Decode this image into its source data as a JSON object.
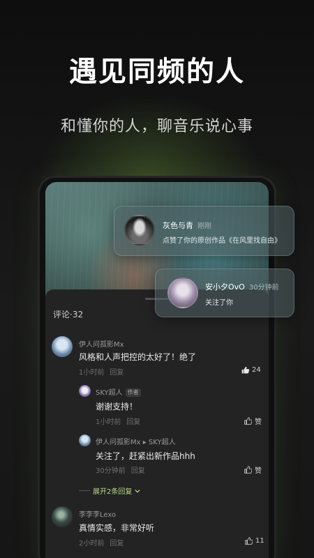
{
  "hero": {
    "title": "遇见同频的人",
    "subtitle": "和懂你的人，聊音乐说心事"
  },
  "notifications": [
    {
      "name": "灰色与青",
      "time": "刚刚",
      "desc": "点赞了你的原创作品《在风里找自由》"
    },
    {
      "name": "安小夕OvO",
      "time": "30分钟前",
      "desc": "关注了你"
    }
  ],
  "comments": {
    "header": "评论·32",
    "items": [
      {
        "user": "伊人问孤影Mx",
        "text": "风格和人声把控的太好了！绝了",
        "time": "1小时前",
        "reply": "回复",
        "likes": "24"
      },
      {
        "user": "SKY超人",
        "author_tag": "作者",
        "text": "谢谢支持！",
        "time": "1小时前",
        "reply": "回复",
        "likes": "赞"
      },
      {
        "user": "伊人问孤影Mx ▸ SKY超人",
        "text": "关注了，赶紧出新作品hhh",
        "time": "30分钟前",
        "reply": "回复",
        "likes": "赞"
      },
      {
        "user": "李李李Lexo",
        "text": "真情实感，非常好听",
        "time": "2小时前",
        "reply": "回复",
        "likes": "11"
      }
    ],
    "expand_label": "展开2条回复"
  },
  "colors": {
    "accent": "#b6d98a",
    "background": "#141414",
    "card": "#505f64"
  },
  "icons": {
    "like": "thumbs-up-icon",
    "chevron": "chevron-down-icon"
  }
}
